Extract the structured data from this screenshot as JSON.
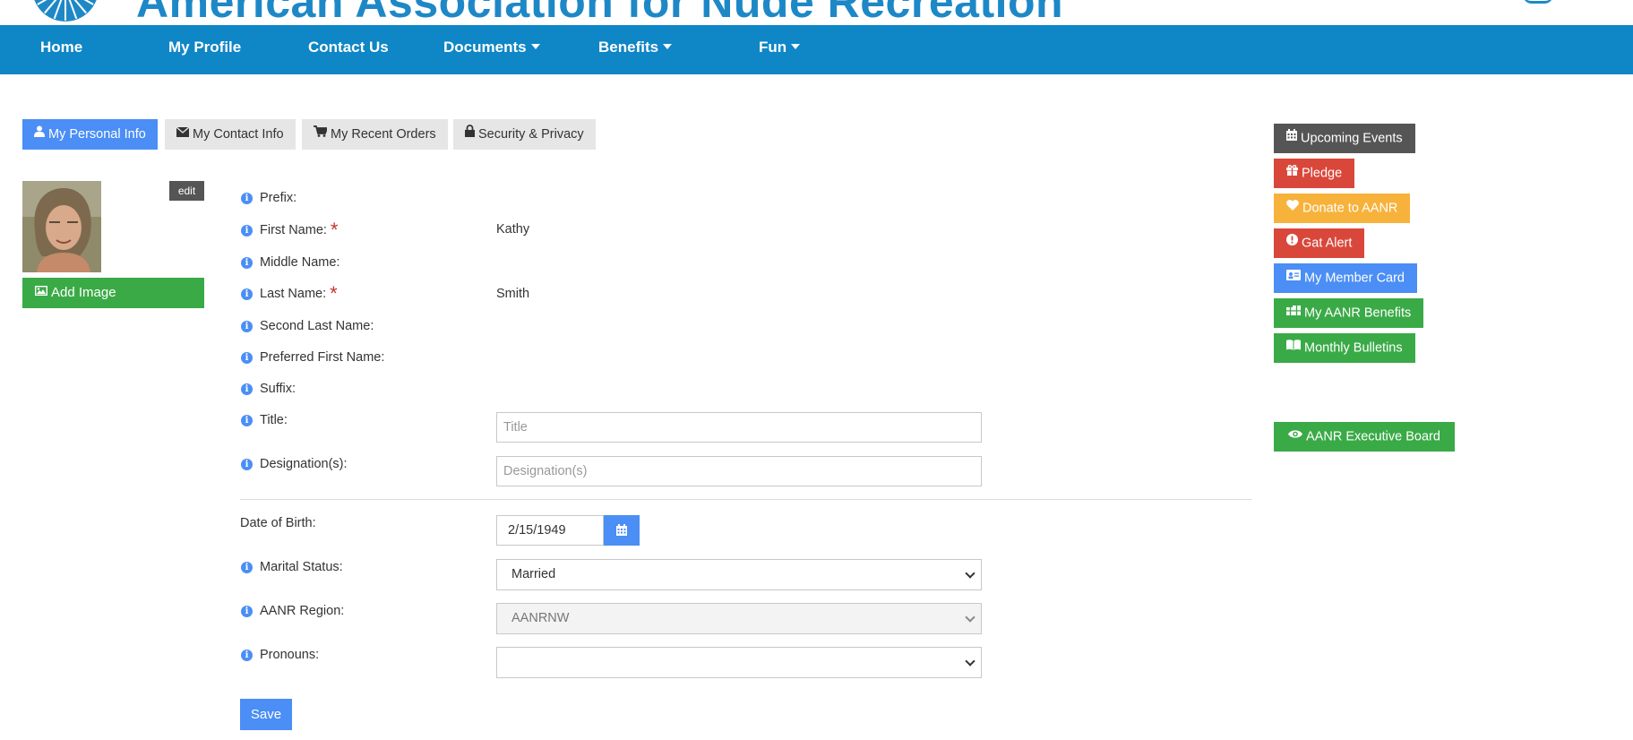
{
  "header": {
    "site_title": "American Association for Nude Recreation"
  },
  "nav": {
    "items": [
      {
        "label": "Home",
        "dropdown": false
      },
      {
        "label": "My Profile",
        "dropdown": false
      },
      {
        "label": "Contact Us",
        "dropdown": false
      },
      {
        "label": "Documents",
        "dropdown": true
      },
      {
        "label": "Benefits",
        "dropdown": true
      },
      {
        "label": "Fun",
        "dropdown": true
      }
    ]
  },
  "tabs": [
    {
      "label": "My Personal Info",
      "icon": "user-icon",
      "active": true
    },
    {
      "label": "My Contact Info",
      "icon": "envelope-icon",
      "active": false
    },
    {
      "label": "My Recent Orders",
      "icon": "cart-icon",
      "active": false
    },
    {
      "label": "Security & Privacy",
      "icon": "lock-icon",
      "active": false
    }
  ],
  "photo": {
    "edit_label": "edit",
    "add_image_label": "Add Image"
  },
  "form": {
    "fields": {
      "prefix": {
        "label": "Prefix:",
        "value": ""
      },
      "first_name": {
        "label": "First Name:",
        "value": "Kathy",
        "required": true
      },
      "middle_name": {
        "label": "Middle Name:",
        "value": ""
      },
      "last_name": {
        "label": "Last Name:",
        "value": "Smith",
        "required": true
      },
      "second_last_name": {
        "label": "Second Last Name:",
        "value": ""
      },
      "preferred_first_name": {
        "label": "Preferred First Name:",
        "value": ""
      },
      "suffix": {
        "label": "Suffix:",
        "value": ""
      },
      "title": {
        "label": "Title:",
        "value": "",
        "placeholder": "Title"
      },
      "designations": {
        "label": "Designation(s):",
        "value": "",
        "placeholder": "Designation(s)"
      }
    },
    "required_mark": "*",
    "date_of_birth": {
      "label": "Date of Birth:",
      "value": "2/15/1949"
    },
    "marital_status": {
      "label": "Marital Status:",
      "value": "Married"
    },
    "aanr_region": {
      "label": "AANR Region:",
      "value": "AANRNW",
      "disabled": true
    },
    "pronouns": {
      "label": "Pronouns:",
      "value": ""
    },
    "save_label": "Save"
  },
  "sidebar": {
    "buttons": [
      {
        "label": "Upcoming Events",
        "icon": "calendar-icon",
        "color": "#555555"
      },
      {
        "label": "Pledge",
        "icon": "gift-icon",
        "color": "#d9473a"
      },
      {
        "label": "Donate to AANR",
        "icon": "heart-icon",
        "color": "#f7b23b"
      },
      {
        "label": "Gat Alert",
        "icon": "alert-icon",
        "color": "#d9473a"
      },
      {
        "label": "My Member Card",
        "icon": "id-card-icon",
        "color": "#4b8ef5"
      },
      {
        "label": "My AANR Benefits",
        "icon": "gifts-icon",
        "color": "#3aaa47"
      },
      {
        "label": "Monthly Bulletins",
        "icon": "book-icon",
        "color": "#3aaa47"
      },
      {
        "label": "AANR Executive Board",
        "icon": "eye-icon",
        "color": "#3aaa47"
      }
    ]
  },
  "colors": {
    "nav_bg": "#0f86c6",
    "primary": "#4b8ef5",
    "success": "#3aaa47",
    "danger": "#d9473a",
    "warning": "#f7b23b",
    "dark": "#555555"
  }
}
